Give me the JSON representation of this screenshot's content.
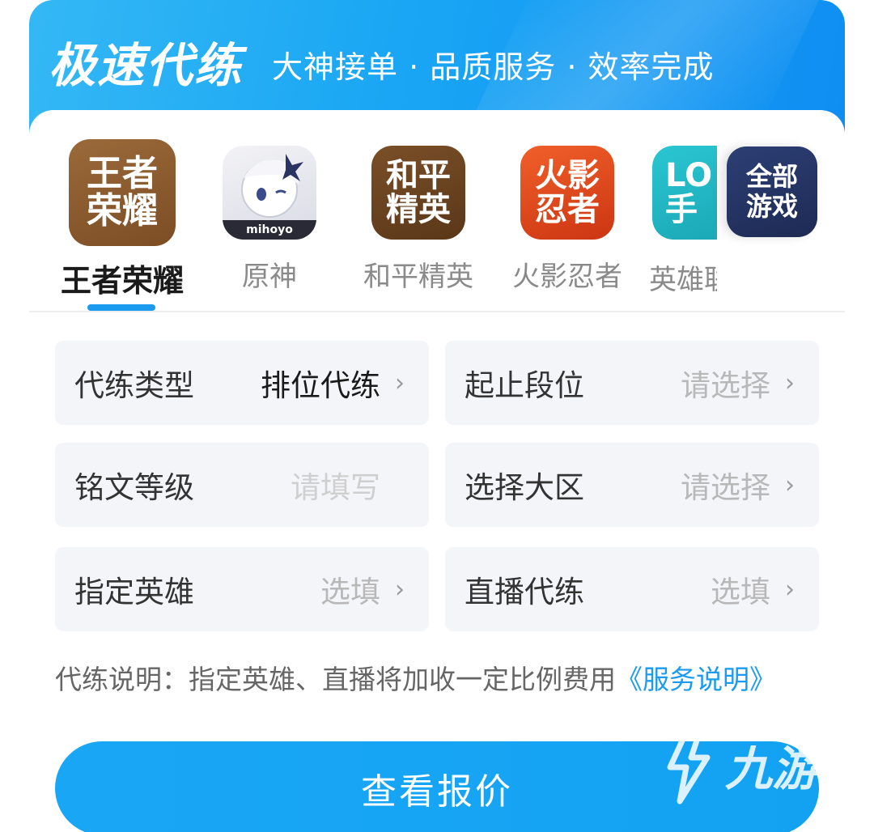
{
  "header": {
    "title": "极速代练",
    "subtitle": "大神接单 · 品质服务 · 效率完成"
  },
  "games": [
    {
      "label": "王者荣耀",
      "icon_text": [
        "王者",
        "荣耀"
      ],
      "active": true
    },
    {
      "label": "原神",
      "icon_text": [
        "mihoyo"
      ],
      "active": false
    },
    {
      "label": "和平精英",
      "icon_text": [
        "和平",
        "精英"
      ],
      "active": false
    },
    {
      "label": "火影忍者",
      "icon_text": [
        "火影",
        "忍者"
      ],
      "active": false
    },
    {
      "label": "英雄联",
      "icon_text": [
        "LO",
        "手"
      ],
      "active": false
    }
  ],
  "all_games": [
    "全部",
    "游戏"
  ],
  "colors": {
    "accent": "#1a9bf0",
    "wangzhe_icon": "#8a5a2e",
    "heping_icon": "#6b4420",
    "huoying_icon": "#e0461f",
    "lol_icon": "#23b8c4"
  },
  "form": {
    "fields": [
      {
        "label": "代练类型",
        "value": "排位代练",
        "filled": true,
        "chevron": true
      },
      {
        "label": "起止段位",
        "value": "请选择",
        "filled": false,
        "chevron": true
      },
      {
        "label": "铭文等级",
        "value": "请填写",
        "filled": false,
        "chevron": false
      },
      {
        "label": "选择大区",
        "value": "请选择",
        "filled": false,
        "chevron": true
      },
      {
        "label": "指定英雄",
        "value": "选填",
        "filled": false,
        "chevron": true
      },
      {
        "label": "直播代练",
        "value": "选填",
        "filled": false,
        "chevron": true
      }
    ]
  },
  "note": {
    "text": "代练说明：指定英雄、直播将加收一定比例费用",
    "link": "《服务说明》"
  },
  "button": {
    "label": "查看报价"
  },
  "watermark": {
    "text": "九游"
  }
}
